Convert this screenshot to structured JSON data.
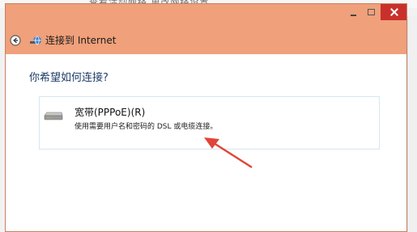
{
  "window": {
    "title": "连接到 Internet",
    "question": "你希望如何连接?",
    "colors": {
      "titlebar": "#f0a07a",
      "close": "#c9302c",
      "question": "#1f3d6a"
    }
  },
  "options": [
    {
      "title": "宽带(PPPoE)(R)",
      "description": "使用需要用户名和密码的 DSL 或电缆连接。",
      "icon": "modem-icon"
    }
  ],
  "annotation": {
    "arrow_color": "#e0453a"
  },
  "icons": [
    "back-arrow-icon",
    "network-icon",
    "modem-icon",
    "minimize-icon",
    "maximize-icon",
    "close-icon"
  ]
}
